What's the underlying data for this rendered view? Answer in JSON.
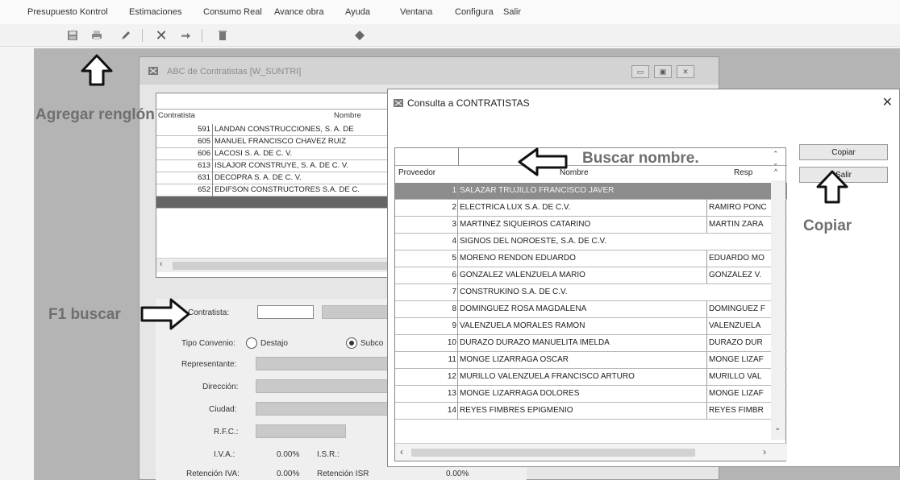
{
  "menubar": {
    "items": [
      {
        "label": "Presupuesto Kontrol"
      },
      {
        "label": "Estimaciones"
      },
      {
        "label": "Consumo Real"
      },
      {
        "label": "Avance obra"
      },
      {
        "label": "Ayuda"
      },
      {
        "label": "Ventana"
      },
      {
        "label": "Configura"
      },
      {
        "label": "Salir"
      }
    ]
  },
  "abc_window": {
    "title": "ABC de Contratistas [W_SUNTRI]",
    "columns": [
      "Contratista",
      "Nombre"
    ],
    "rows": [
      {
        "id": "591",
        "name": "LANDAN CONSTRUCCIONES, S. A. DE"
      },
      {
        "id": "605",
        "name": "MANUEL FRANCISCO CHAVEZ RUIZ"
      },
      {
        "id": "606",
        "name": "LACOSI S. A. DE C. V."
      },
      {
        "id": "613",
        "name": "ISLAJOR CONSTRUYE, S. A. DE C. V."
      },
      {
        "id": "631",
        "name": "DECOPRA S. A. DE C. V."
      },
      {
        "id": "652",
        "name": "EDIFSON CONSTRUCTORES S.A. DE C."
      }
    ],
    "form": {
      "contratista_label": "Contratista:",
      "contratista_value": "",
      "tipo_convenio_label": "Tipo Convenio:",
      "opt_destajo": "Destajo",
      "opt_subcontrato": "Subco",
      "representante_label": "Representante:",
      "direccion_label": "Dirección:",
      "ciudad_label": "Ciudad:",
      "rfc_label": "R.F.C.:",
      "iva_label": "I.V.A.:",
      "iva_value": "0.00%",
      "isr_label": "I.S.R.:",
      "ret_iva_label": "Retención IVA:",
      "ret_iva_value": "0.00%",
      "ret_isr_label": "Retención ISR",
      "ret_isr_value": "0.00%"
    }
  },
  "consulta": {
    "title": "Consulta a CONTRATISTAS",
    "close_glyph": "✕",
    "search_value": "",
    "columns": [
      "Proveedor",
      "Nombre",
      "Resp"
    ],
    "rows": [
      {
        "id": "1",
        "name": "SALAZAR TRUJILLO FRANCISCO JAVER",
        "resp": ""
      },
      {
        "id": "2",
        "name": "ELECTRICA LUX S.A. DE C.V.",
        "resp": "RAMIRO PONC"
      },
      {
        "id": "3",
        "name": "MARTINEZ SIQUEIROS CATARINO",
        "resp": "MARTIN ZARA"
      },
      {
        "id": "4",
        "name": "SIGNOS DEL NOROESTE, S.A. DE C.V.",
        "resp": ""
      },
      {
        "id": "5",
        "name": "MORENO RENDON EDUARDO",
        "resp": "EDUARDO MO"
      },
      {
        "id": "6",
        "name": "GONZALEZ VALENZUELA MARIO",
        "resp": "GONZALEZ V."
      },
      {
        "id": "7",
        "name": "CONSTRUKINO S.A. DE C.V.",
        "resp": ""
      },
      {
        "id": "8",
        "name": "DOMINGUEZ ROSA MAGDALENA",
        "resp": "DOMINGUEZ F"
      },
      {
        "id": "9",
        "name": "VALENZUELA MORALES RAMON",
        "resp": "VALENZUELA"
      },
      {
        "id": "10",
        "name": "DURAZO DURAZO MANUELITA IMELDA",
        "resp": "DURAZO DUR"
      },
      {
        "id": "11",
        "name": "MONGE LIZARRAGA OSCAR",
        "resp": "MONGE LIZAF"
      },
      {
        "id": "12",
        "name": "MURILLO VALENZUELA FRANCISCO ARTURO",
        "resp": "MURILLO VAL"
      },
      {
        "id": "13",
        "name": "MONGE LIZARRAGA DOLORES",
        "resp": "MONGE LIZAF"
      },
      {
        "id": "14",
        "name": "REYES FIMBRES EPIGMENIO",
        "resp": "REYES FIMBR"
      }
    ],
    "copiar_label": "Copiar",
    "salir_label": "Salir"
  },
  "annotations": {
    "agregar": "Agregar renglón",
    "buscar_nombre": "Buscar nombre.",
    "copiar": "Copiar",
    "f1_buscar": "F1 buscar"
  },
  "icons": {
    "toolbar": [
      "save-icon",
      "print-icon",
      "edit-icon",
      "delete-x-icon",
      "insert-row-icon",
      "trash-icon",
      "diamond-icon"
    ]
  }
}
